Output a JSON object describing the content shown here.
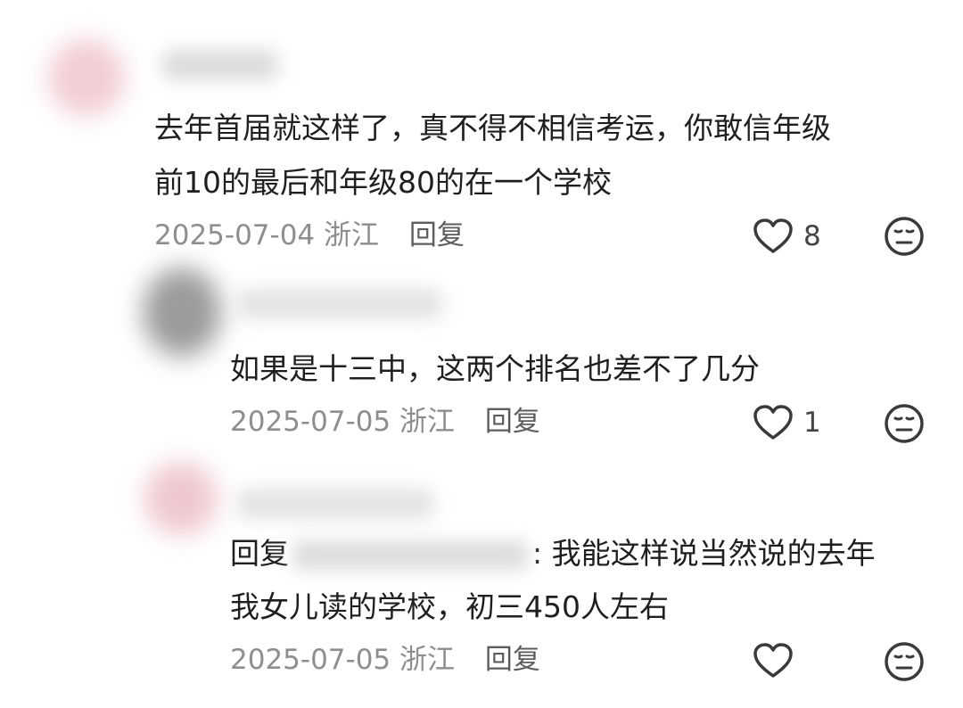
{
  "comments": [
    {
      "text_line_1": "去年首届就这样了，真不得不相信考运，你敢信年级",
      "text_line_2": "前10的最后和年级80的在一个学校",
      "date": "2025-07-04",
      "location": "浙江",
      "reply_label": "回复",
      "likes": "8"
    },
    {
      "text_line_1": "如果是十三中，这两个排名也差不了几分",
      "date": "2025-07-05",
      "location": "浙江",
      "reply_label": "回复",
      "likes": "1"
    },
    {
      "reply_prefix": "回复",
      "text_line_1_suffix": ": 我能这样说当然说的去年",
      "text_line_2": "我女儿读的学校，初三450人左右",
      "date": "2025-07-05",
      "location": "浙江",
      "reply_label": "回复",
      "likes": ""
    }
  ],
  "icons": {
    "like": "heart-outline-icon",
    "dislike": "neutral-face-icon"
  }
}
